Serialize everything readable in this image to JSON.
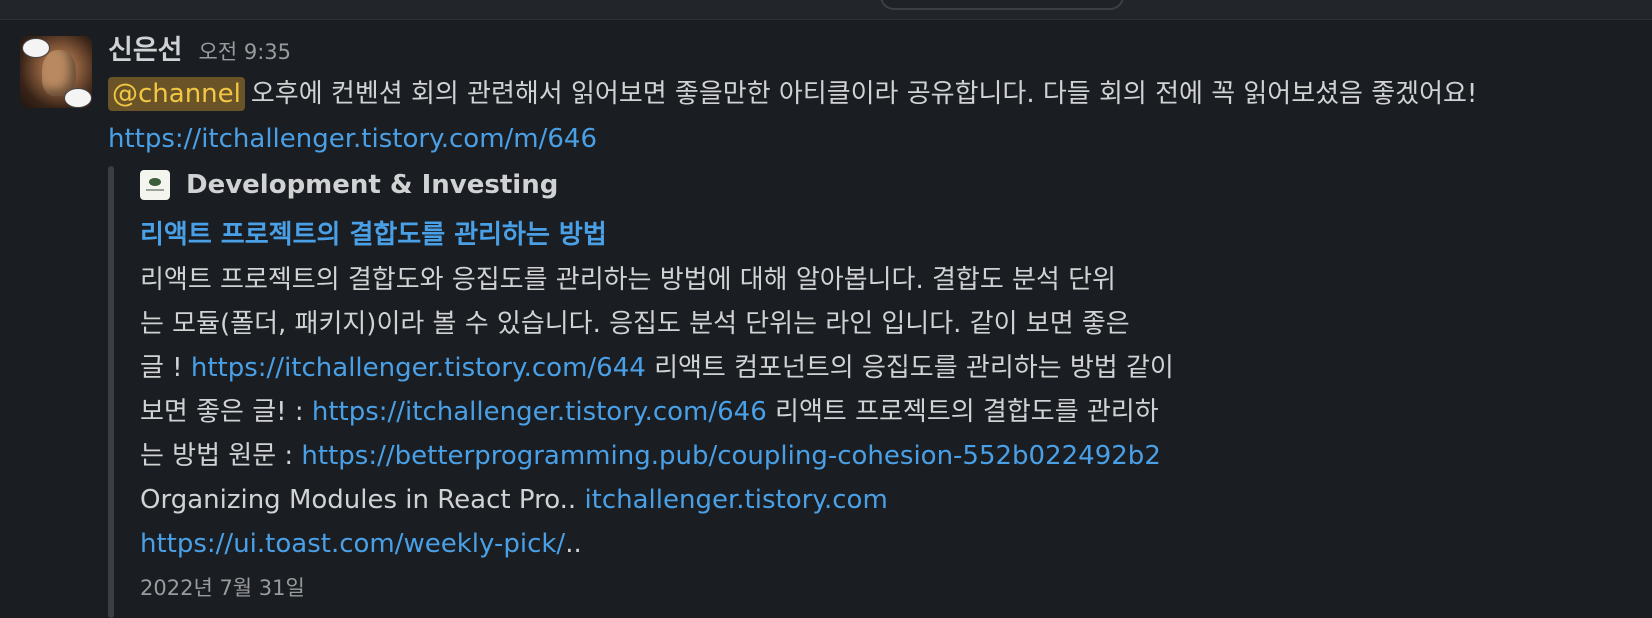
{
  "message": {
    "author": "신은선",
    "timestamp": "오전 9:35",
    "mention": "@channel",
    "text": "오후에 컨벤션 회의 관련해서 읽어보면 좋을만한 아티클이라 공유합니다. 다들 회의 전에 꼭 읽어보셨음 좋겠어요!",
    "link": "https://itchallenger.tistory.com/m/646"
  },
  "attachment": {
    "source_name": "Development & Investing",
    "title": "리액트 프로젝트의 결합도를 관리하는 방법",
    "body_line1": "리액트 프로젝트의 결합도와 응집도를 관리하는 방법에 대해 알아봅니다. 결합도 분석 단위",
    "body_line2": "는 모듈(폴더, 패키지)이라 볼 수 있습니다. 응집도 분석 단위는 라인 입니다. 같이 보면 좋은",
    "body_line3_prefix": "글 ! ",
    "body_line3_link": "https://itchallenger.tistory.com/644",
    "body_line3_suffix": " 리액트 컴포넌트의 응집도를 관리하는 방법 같이",
    "body_line4_prefix": "보면 좋은 글! : ",
    "body_line4_link": "https://itchallenger.tistory.com/646",
    "body_line4_suffix": " 리액트 프로젝트의 결합도를 관리하",
    "body_line5_prefix": "는 방법 원문 : ",
    "body_line5_link": "https://betterprogramming.pub/coupling-cohesion-552b022492b2",
    "body_line6_prefix": "Organizing Modules in React Pro.. ",
    "body_line6_link": "itchallenger.tistory.com",
    "body_line7_link": "https://ui.toast.com/weekly-pick/",
    "body_line7_suffix": "..",
    "date": "2022년 7월 31일"
  },
  "colors": {
    "background": "#1a1d21",
    "text": "#d1d2d3",
    "link": "#4aa0e6",
    "mention_bg": "#6a5427",
    "mention_text": "#f2c744",
    "muted": "#9a9b9d"
  }
}
